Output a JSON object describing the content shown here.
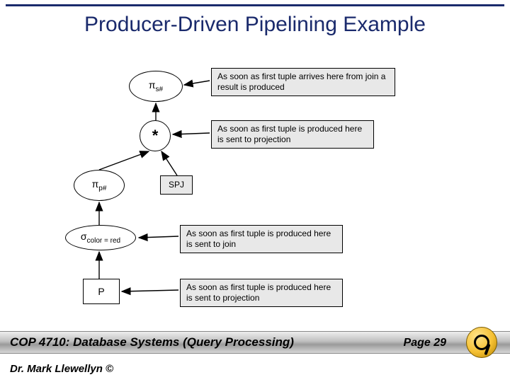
{
  "title": "Producer-Driven Pipelining Example",
  "nodes": {
    "pi_s": {
      "symbol": "π",
      "sub": "s#"
    },
    "star": {
      "label": "*"
    },
    "pi_p": {
      "symbol": "π",
      "sub": "p#"
    },
    "sigma": {
      "symbol": "σ",
      "sub": "color = red"
    },
    "p": {
      "label": "P"
    }
  },
  "callouts": {
    "c1": "As soon as first tuple arrives here from join a result is produced",
    "c2": "As soon as first tuple is produced here is sent to projection",
    "spj": "SPJ",
    "c3": "As soon as first tuple is produced here is sent to join",
    "c4": "As soon as first tuple is produced here is sent to projection"
  },
  "footer": {
    "course": "COP 4710: Database Systems (Query Processing)",
    "page": "Page 29",
    "cutoff": "Dr. Mark Llewellyn ©"
  }
}
